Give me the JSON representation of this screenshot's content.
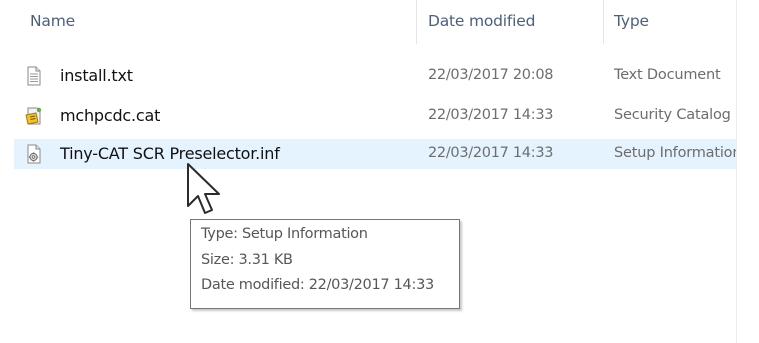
{
  "columns": {
    "name": "Name",
    "date_modified": "Date modified",
    "type": "Type"
  },
  "files": [
    {
      "name": "install.txt",
      "date": "22/03/2017 20:08",
      "type": "Text Document",
      "icon": "text-file-icon"
    },
    {
      "name": "mchpcdc.cat",
      "date": "22/03/2017 14:33",
      "type": "Security Catalog",
      "icon": "security-catalog-icon"
    },
    {
      "name": "Tiny-CAT SCR Preselector.inf",
      "date": "22/03/2017 14:33",
      "type": "Setup Information",
      "icon": "setup-information-icon"
    }
  ],
  "tooltip": {
    "type_line": "Type: Setup Information",
    "size_line": "Size: 3.31 KB",
    "date_line": "Date modified: 22/03/2017 14:33"
  },
  "colors": {
    "header_text": "#4c607a",
    "hover_row": "#e5f3ff",
    "secondary_text": "#6d6d6d"
  }
}
